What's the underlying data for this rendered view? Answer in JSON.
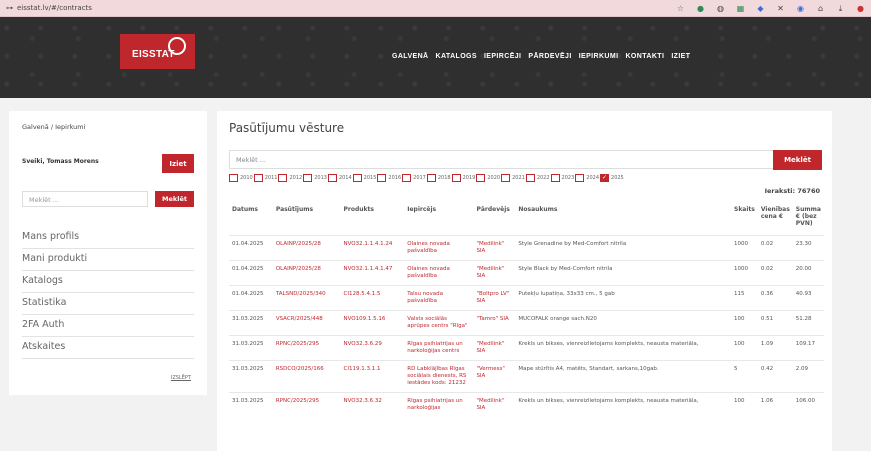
{
  "browser": {
    "url": "eisstat.lv/#/contracts"
  },
  "header": {
    "logo": "EISSTAT",
    "nav": [
      "GALVENĀ",
      "KATALOGS",
      "IEPIRCĒJI",
      "PĀRDEVĒJI",
      "IEPIRKUMI",
      "KONTAKTI",
      "IZIET"
    ]
  },
  "sidebar": {
    "breadcrumb": "Galvenā  /  Iepirkumi",
    "user": "Sveiki, Tomass Morens",
    "logout_label": "Iziet",
    "search_placeholder": "Meklēt ...",
    "search_button": "Meklēt",
    "menu": [
      "Mans profils",
      "Mani produkti",
      "Katalogs",
      "Statistika",
      "2FA Auth",
      "Atskaites"
    ],
    "collapse_label": "IZSLĒPT"
  },
  "main": {
    "title": "Pasūtījumu vēsture",
    "search_placeholder": "Meklēt ...",
    "search_button": "Meklēt",
    "years": [
      {
        "label": "2010",
        "checked": false
      },
      {
        "label": "2011",
        "checked": false
      },
      {
        "label": "2012",
        "checked": false
      },
      {
        "label": "2013",
        "checked": false
      },
      {
        "label": "2014",
        "checked": false
      },
      {
        "label": "2015",
        "checked": false
      },
      {
        "label": "2016",
        "checked": false
      },
      {
        "label": "2017",
        "checked": false
      },
      {
        "label": "2018",
        "checked": false
      },
      {
        "label": "2019",
        "checked": false
      },
      {
        "label": "2020",
        "checked": false
      },
      {
        "label": "2021",
        "checked": false
      },
      {
        "label": "2022",
        "checked": false
      },
      {
        "label": "2023",
        "checked": false
      },
      {
        "label": "2024",
        "checked": false
      },
      {
        "label": "2025",
        "checked": true
      }
    ],
    "record_count": "Ieraksti: 76760",
    "columns": [
      "Datums",
      "Pasūtījums",
      "Produkts",
      "Iepircējs",
      "Pārdevējs",
      "Nosaukums",
      "Skaits",
      "Vienības cena €",
      "Summa € (bez PVN)"
    ],
    "rows": [
      [
        "01.04.2025",
        "OLAINP/2025/28",
        "NVO32.1.1.4.1.24",
        "Olaines novada pašvaldība",
        "\"Medilink\" SIA",
        "Style Grenadine by Med-Comfort nitrila",
        "1000",
        "0.02",
        "23.30"
      ],
      [
        "01.04.2025",
        "OLAINP/2025/28",
        "NVO32.1.1.4.1.47",
        "Olaines novada pašvaldība",
        "\"Medilink\" SIA",
        "Style Black by Med-Comfort nitrila",
        "1000",
        "0.02",
        "20.00"
      ],
      [
        "01.04.2025",
        "TALSND/2025/340",
        "CI128.5.4.1.5",
        "Talsu novada pašvaldība",
        "\"Boltpro LV\" SIA",
        "Putekļu lupatiņa, 33x33 cm., 5 gab",
        "115",
        "0.36",
        "40.93"
      ],
      [
        "31.03.2025",
        "VSACR/2025/448",
        "NVO109.1.5.16",
        "Valsts sociālās aprūpes centrs \"Rīga\"",
        "\"Tamro\" SIA",
        "MUCOFALK orange sach.N20",
        "100",
        "0.51",
        "51.28"
      ],
      [
        "31.03.2025",
        "RPNC/2025/295",
        "NVO32.3.6.29",
        "Rīgas psihiatrijas un narkoloģijas centrs",
        "\"Medilink\" SIA",
        "Krekls un bikses, vienreizlietojams komplekts, neausta materiāla,",
        "100",
        "1.09",
        "109.17"
      ],
      [
        "31.03.2025",
        "RSDCO/2025/166",
        "CI119.1.3.1.1",
        "RD Labklājības Rīgas sociālais dienests, RS iestādes kods: 21232",
        "\"Vermess\" SIA",
        "Mape stūrītis A4, matēts, Standart, sarkans,10gab.",
        "5",
        "0.42",
        "2.09"
      ],
      [
        "31.03.2025",
        "RPNC/2025/295",
        "NVO32.3.6.32",
        "Rīgas psihiatrijas un narkoloģijas",
        "\"Medilink\" SIA",
        "Krekls un bikses, vienreizlietojams komplekts, neausta materiāla,",
        "100",
        "1.06",
        "106.00"
      ]
    ]
  }
}
